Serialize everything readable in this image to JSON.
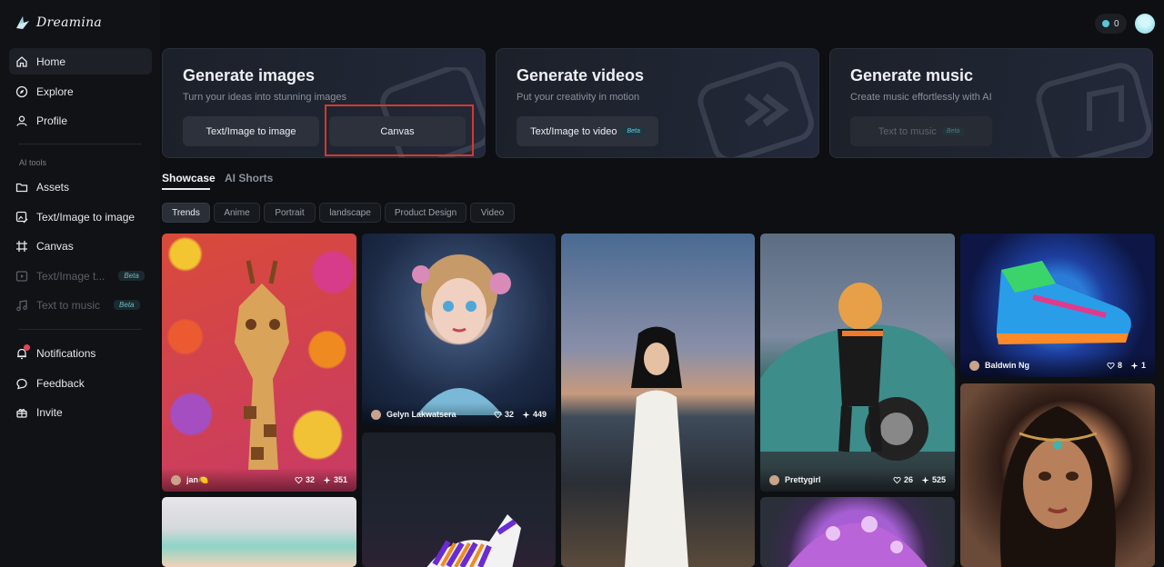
{
  "app": {
    "name": "Dreamina"
  },
  "topbar": {
    "credits": "0"
  },
  "sidebar": {
    "items": [
      {
        "label": "Home",
        "icon": "home-icon"
      },
      {
        "label": "Explore",
        "icon": "compass-icon"
      },
      {
        "label": "Profile",
        "icon": "user-icon"
      }
    ],
    "section_label": "AI tools",
    "tools": [
      {
        "label": "Assets",
        "icon": "folder-icon"
      },
      {
        "label": "Text/Image to image",
        "icon": "image-edit-icon"
      },
      {
        "label": "Canvas",
        "icon": "canvas-icon"
      },
      {
        "label": "Text/Image t...",
        "icon": "video-icon",
        "badge": "Beta"
      },
      {
        "label": "Text to music",
        "icon": "music-icon",
        "badge": "Beta"
      }
    ],
    "footer": [
      {
        "label": "Notifications",
        "icon": "bell-icon"
      },
      {
        "label": "Feedback",
        "icon": "chat-icon"
      },
      {
        "label": "Invite",
        "icon": "gift-icon"
      }
    ]
  },
  "cards": [
    {
      "title": "Generate images",
      "subtitle": "Turn your ideas into stunning images",
      "buttons": [
        {
          "label": "Text/Image to image"
        },
        {
          "label": "Canvas"
        }
      ]
    },
    {
      "title": "Generate videos",
      "subtitle": "Put your creativity in motion",
      "buttons": [
        {
          "label": "Text/Image to video",
          "badge": "Beta"
        }
      ]
    },
    {
      "title": "Generate music",
      "subtitle": "Create music effortlessly with AI",
      "buttons": [
        {
          "label": "Text to music",
          "badge": "Beta"
        }
      ]
    }
  ],
  "tabs": [
    "Showcase",
    "AI Shorts"
  ],
  "filters": [
    "Trends",
    "Anime",
    "Portrait",
    "landscape",
    "Product Design",
    "Video"
  ],
  "gallery": [
    {
      "user": "jan🍋",
      "likes": "32",
      "remixes": "351"
    },
    {
      "user": "Gelyn Lakwatsera",
      "likes": "32",
      "remixes": "449"
    },
    {
      "user": "Prettygirl",
      "likes": "26",
      "remixes": "525"
    },
    {
      "user": "Baldwin Ng",
      "likes": "8",
      "remixes": "1"
    }
  ],
  "colors": {
    "accent": "#5fc3d6",
    "highlight_box": "#d43a2a",
    "background": "#0d0f12"
  }
}
